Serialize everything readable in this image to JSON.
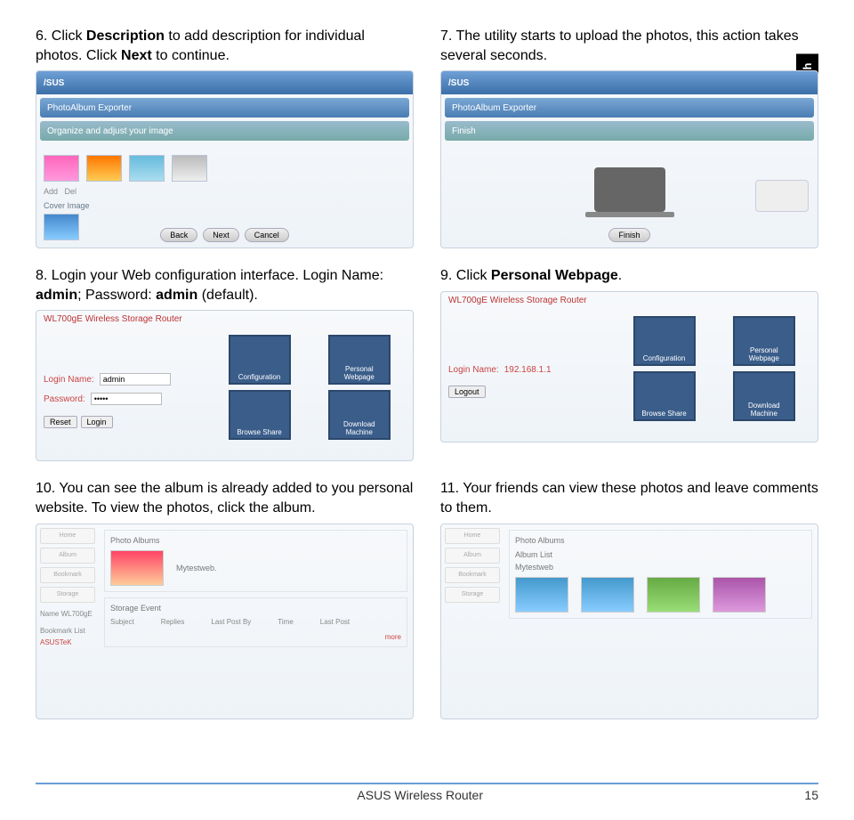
{
  "side_tag": "English",
  "steps": {
    "s6": {
      "n": "6.",
      "a": "Click ",
      "b1": "Description",
      "c": " to add description for individual photos. Click ",
      "b2": "Next",
      "d": " to continue."
    },
    "s7": {
      "n": "7.",
      "text": "The utility starts to upload the photos, this action takes several seconds."
    },
    "s8": {
      "n": "8.",
      "a": "Login your Web configuration interface. Login Name: ",
      "b1": "admin",
      "c": "; Password: ",
      "b2": "admin",
      "d": " (default)."
    },
    "s9": {
      "n": "9.",
      "a": "Click ",
      "b1": "Personal Webpage",
      "d": "."
    },
    "s10": {
      "n": "10.",
      "text": "You can see the album is already added to you personal website. To view the photos, click the album."
    },
    "s11": {
      "n": "11.",
      "text": "Your friends can view these photos and leave comments to them."
    }
  },
  "shot_exporter": {
    "brand": "/SUS",
    "title": "PhotoAlbum Exporter",
    "sub_organize": "Organize and adjust your image",
    "sub_finish": "Finish",
    "labels": {
      "add": "Add",
      "del": "Del",
      "cover": "Cover Image"
    },
    "btns": {
      "back": "Back",
      "next": "Next",
      "cancel": "Cancel",
      "finish": "Finish"
    }
  },
  "shot_cfg": {
    "title": "WL700gE Wireless Storage Router",
    "login_name": "Login Name:",
    "password": "Password:",
    "val_name": "admin",
    "val_pass": "•••••",
    "btn_reset": "Reset",
    "btn_login": "Login",
    "btn_logout": "Logout",
    "ip": "192.168.1.1",
    "tiles": {
      "config": "Configuration",
      "pw": "Personal Webpage",
      "browse": "Browse Share",
      "dm": "Download Machine"
    }
  },
  "shot_album": {
    "side": [
      "Home",
      "Album",
      "Bookmark",
      "Storage"
    ],
    "name_lbl": "Name",
    "name_val": "WL700gE",
    "bookmark": "Bookmark List",
    "bm_item": "ASUSTeK",
    "photo_albums": "Photo Albums",
    "album_lbl": "Mytestweb.",
    "storage": "Storage Event",
    "cols": [
      "Subject",
      "Replies",
      "Last Post By",
      "Time",
      "Last Post"
    ],
    "more": "more",
    "list_lbl": "Album List",
    "item": "Mytestweb"
  },
  "footer": {
    "center": "ASUS Wireless Router",
    "page": "15"
  }
}
